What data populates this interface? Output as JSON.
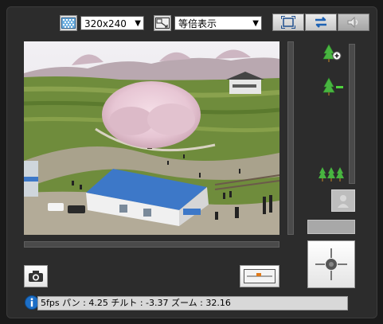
{
  "toolbar": {
    "resolution_icon": "resolution-grid-icon",
    "resolution_value": "320x240",
    "zoom_mode_icon": "zoom-mode-icon",
    "zoom_mode_value": "等倍表示",
    "fullscreen_icon": "fullscreen-icon",
    "swap_icon": "swap-arrows-icon",
    "audio_icon": "speaker-icon"
  },
  "camera_view": {
    "image_icon": "camera-live-image",
    "colors": {
      "sky": "#e8e4e8",
      "grass": "#6b8a3a",
      "roof": "#3d78c8"
    }
  },
  "zoom_panel": {
    "zoom_in_icon": "tree-plus-icon",
    "zoom_out_icon": "tree-minus-icon",
    "wide_icon": "three-trees-icon",
    "level": 0.32
  },
  "controls": {
    "snapshot_icon": "camera-icon",
    "preset_icon": "preset-position-icon",
    "disabled_person_icon": "person-icon",
    "joystick_icon": "pan-tilt-joystick-icon"
  },
  "status": {
    "info_icon": "info-icon",
    "text": "5fps パン : 4.25 チルト : -3.37 ズーム : 32.16"
  }
}
